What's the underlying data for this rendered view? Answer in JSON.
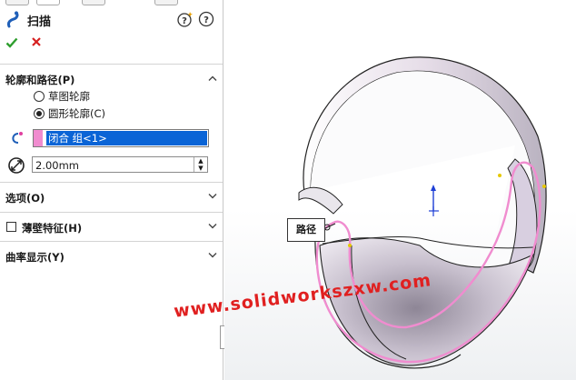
{
  "feature": {
    "title": "扫描"
  },
  "sections": {
    "profile_path": {
      "label": "轮廓和路径(P)",
      "options": [
        "草图轮廓",
        "圆形轮廓(C)"
      ],
      "selected_option": "圆形轮廓(C)",
      "path_selection": "闭合 组<1>",
      "diameter": "2.00mm"
    },
    "options": {
      "label": "选项(O)"
    },
    "thin_feature": {
      "label": "薄壁特征(H)",
      "checked": false
    },
    "curvature": {
      "label": "曲率显示(Y)"
    }
  },
  "viewport": {
    "path_callout": "路径",
    "watermark": "www.solidworkszxw.com"
  },
  "colors": {
    "selection_highlight": "#0a64d6",
    "path_pink": "#f08ccf",
    "watermark_red": "#e02020",
    "ok_green": "#2e9e2e",
    "cancel_red": "#d62020"
  }
}
